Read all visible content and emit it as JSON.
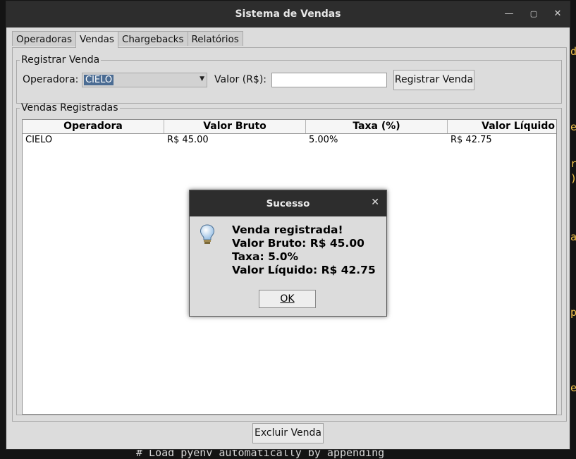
{
  "window": {
    "title": "Sistema de Vendas"
  },
  "tabs": [
    {
      "label": "Operadoras"
    },
    {
      "label": "Vendas"
    },
    {
      "label": "Chargebacks"
    },
    {
      "label": "Relatórios"
    }
  ],
  "register": {
    "legend": "Registrar Venda",
    "operadora_label": "Operadora:",
    "operadora_value": "CIELO",
    "valor_label": "Valor (R$):",
    "valor_value": "",
    "submit_label": "Registrar Venda"
  },
  "sales": {
    "legend": "Vendas Registradas",
    "columns": [
      "Operadora",
      "Valor Bruto",
      "Taxa (%)",
      "Valor Líquido"
    ],
    "rows": [
      [
        "CIELO",
        "R$ 45.00",
        "5.00%",
        "R$ 42.75"
      ]
    ]
  },
  "footer": {
    "delete_label": "Excluir Venda"
  },
  "dialog": {
    "title": "Sucesso",
    "lines": [
      "Venda registrada!",
      "Valor Bruto: R$ 45.00",
      "Taxa: 5.0%",
      "Valor Líquido: R$ 42.75"
    ],
    "ok_label": "OK"
  },
  "terminal": {
    "bottom_text": "# Load pyenv automatically by appending",
    "right_chars": [
      "d",
      "e",
      "r",
      ")",
      "a",
      "p",
      "e"
    ]
  },
  "colors": {
    "titlebar": "#2d2d2d",
    "selection": "#4b6c93",
    "window_bg": "#dcdcdc"
  }
}
